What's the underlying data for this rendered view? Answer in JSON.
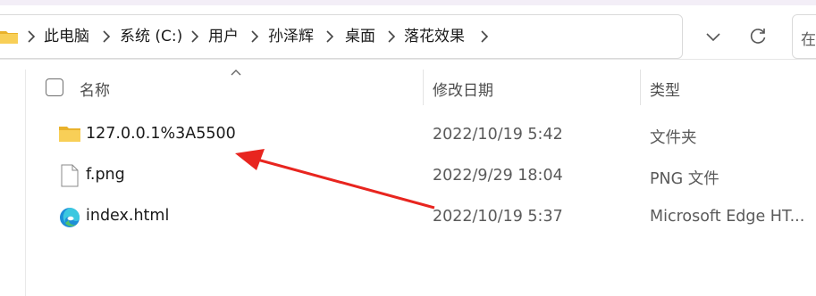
{
  "breadcrumb": {
    "items": [
      "此电脑",
      "系统 (C:)",
      "用户",
      "孙泽辉",
      "桌面",
      "落花效果"
    ]
  },
  "search": {
    "placeholder": "在"
  },
  "columns": {
    "name": "名称",
    "modified": "修改日期",
    "type": "类型"
  },
  "files": [
    {
      "name": "127.0.0.1%3A5500",
      "modified": "2022/10/19 5:42",
      "type": "文件夹",
      "icon": "folder-icon"
    },
    {
      "name": "f.png",
      "modified": "2022/9/29 18:04",
      "type": "PNG 文件",
      "icon": "image-file-icon"
    },
    {
      "name": "index.html",
      "modified": "2022/10/19 5:37",
      "type": "Microsoft Edge HT...",
      "icon": "edge-icon"
    }
  ],
  "colors": {
    "annotation_arrow": "#e8251f",
    "folder": "#f4c648",
    "accent": "#0063b1"
  }
}
